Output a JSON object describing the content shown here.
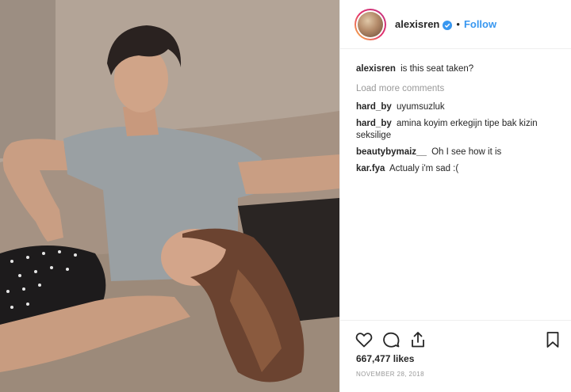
{
  "post": {
    "author": {
      "username": "alexisren",
      "verified": true,
      "separator": "•",
      "follow_label": "Follow"
    },
    "caption": {
      "username": "alexisren",
      "text": "is this seat taken?"
    },
    "load_more_label": "Load more comments",
    "comments": [
      {
        "username": "hard_by",
        "text": "uyumsuzluk"
      },
      {
        "username": "hard_by",
        "text": "amina koyim erkegijn tipe bak kizin seksilige"
      },
      {
        "username": "beautybymaiz__",
        "text": "Oh I see how it is"
      },
      {
        "username": "kar.fya",
        "text": "Actualy i'm sad :("
      }
    ],
    "likes": "667,477 likes",
    "date": "NOVEMBER 28, 2018",
    "icons": {
      "like": "heart-icon",
      "comment": "comment-icon",
      "share": "share-icon",
      "save": "bookmark-icon",
      "verified": "verified-badge-icon"
    },
    "colors": {
      "accent": "#3897f0",
      "muted": "#999999",
      "text": "#262626"
    }
  }
}
